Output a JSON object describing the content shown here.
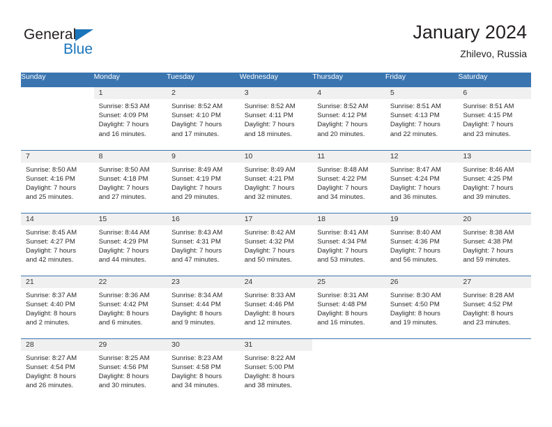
{
  "brand": {
    "word1": "General",
    "word2": "Blue",
    "flag_color": "#1b75bb"
  },
  "header": {
    "title": "January 2024",
    "subtitle": "Zhilevo, Russia"
  },
  "colors": {
    "header_row": "#3a75b0",
    "day_band": "#f0f0f0",
    "text": "#2b2b2b"
  },
  "weekdays": [
    "Sunday",
    "Monday",
    "Tuesday",
    "Wednesday",
    "Thursday",
    "Friday",
    "Saturday"
  ],
  "weeks": [
    [
      {
        "day": "",
        "lines": [],
        "blank": true
      },
      {
        "day": "1",
        "lines": [
          "Sunrise: 8:53 AM",
          "Sunset: 4:09 PM",
          "Daylight: 7 hours",
          "and 16 minutes."
        ]
      },
      {
        "day": "2",
        "lines": [
          "Sunrise: 8:52 AM",
          "Sunset: 4:10 PM",
          "Daylight: 7 hours",
          "and 17 minutes."
        ]
      },
      {
        "day": "3",
        "lines": [
          "Sunrise: 8:52 AM",
          "Sunset: 4:11 PM",
          "Daylight: 7 hours",
          "and 18 minutes."
        ]
      },
      {
        "day": "4",
        "lines": [
          "Sunrise: 8:52 AM",
          "Sunset: 4:12 PM",
          "Daylight: 7 hours",
          "and 20 minutes."
        ]
      },
      {
        "day": "5",
        "lines": [
          "Sunrise: 8:51 AM",
          "Sunset: 4:13 PM",
          "Daylight: 7 hours",
          "and 22 minutes."
        ]
      },
      {
        "day": "6",
        "lines": [
          "Sunrise: 8:51 AM",
          "Sunset: 4:15 PM",
          "Daylight: 7 hours",
          "and 23 minutes."
        ]
      }
    ],
    [
      {
        "day": "7",
        "lines": [
          "Sunrise: 8:50 AM",
          "Sunset: 4:16 PM",
          "Daylight: 7 hours",
          "and 25 minutes."
        ]
      },
      {
        "day": "8",
        "lines": [
          "Sunrise: 8:50 AM",
          "Sunset: 4:18 PM",
          "Daylight: 7 hours",
          "and 27 minutes."
        ]
      },
      {
        "day": "9",
        "lines": [
          "Sunrise: 8:49 AM",
          "Sunset: 4:19 PM",
          "Daylight: 7 hours",
          "and 29 minutes."
        ]
      },
      {
        "day": "10",
        "lines": [
          "Sunrise: 8:49 AM",
          "Sunset: 4:21 PM",
          "Daylight: 7 hours",
          "and 32 minutes."
        ]
      },
      {
        "day": "11",
        "lines": [
          "Sunrise: 8:48 AM",
          "Sunset: 4:22 PM",
          "Daylight: 7 hours",
          "and 34 minutes."
        ]
      },
      {
        "day": "12",
        "lines": [
          "Sunrise: 8:47 AM",
          "Sunset: 4:24 PM",
          "Daylight: 7 hours",
          "and 36 minutes."
        ]
      },
      {
        "day": "13",
        "lines": [
          "Sunrise: 8:46 AM",
          "Sunset: 4:25 PM",
          "Daylight: 7 hours",
          "and 39 minutes."
        ]
      }
    ],
    [
      {
        "day": "14",
        "lines": [
          "Sunrise: 8:45 AM",
          "Sunset: 4:27 PM",
          "Daylight: 7 hours",
          "and 42 minutes."
        ]
      },
      {
        "day": "15",
        "lines": [
          "Sunrise: 8:44 AM",
          "Sunset: 4:29 PM",
          "Daylight: 7 hours",
          "and 44 minutes."
        ]
      },
      {
        "day": "16",
        "lines": [
          "Sunrise: 8:43 AM",
          "Sunset: 4:31 PM",
          "Daylight: 7 hours",
          "and 47 minutes."
        ]
      },
      {
        "day": "17",
        "lines": [
          "Sunrise: 8:42 AM",
          "Sunset: 4:32 PM",
          "Daylight: 7 hours",
          "and 50 minutes."
        ]
      },
      {
        "day": "18",
        "lines": [
          "Sunrise: 8:41 AM",
          "Sunset: 4:34 PM",
          "Daylight: 7 hours",
          "and 53 minutes."
        ]
      },
      {
        "day": "19",
        "lines": [
          "Sunrise: 8:40 AM",
          "Sunset: 4:36 PM",
          "Daylight: 7 hours",
          "and 56 minutes."
        ]
      },
      {
        "day": "20",
        "lines": [
          "Sunrise: 8:38 AM",
          "Sunset: 4:38 PM",
          "Daylight: 7 hours",
          "and 59 minutes."
        ]
      }
    ],
    [
      {
        "day": "21",
        "lines": [
          "Sunrise: 8:37 AM",
          "Sunset: 4:40 PM",
          "Daylight: 8 hours",
          "and 2 minutes."
        ]
      },
      {
        "day": "22",
        "lines": [
          "Sunrise: 8:36 AM",
          "Sunset: 4:42 PM",
          "Daylight: 8 hours",
          "and 6 minutes."
        ]
      },
      {
        "day": "23",
        "lines": [
          "Sunrise: 8:34 AM",
          "Sunset: 4:44 PM",
          "Daylight: 8 hours",
          "and 9 minutes."
        ]
      },
      {
        "day": "24",
        "lines": [
          "Sunrise: 8:33 AM",
          "Sunset: 4:46 PM",
          "Daylight: 8 hours",
          "and 12 minutes."
        ]
      },
      {
        "day": "25",
        "lines": [
          "Sunrise: 8:31 AM",
          "Sunset: 4:48 PM",
          "Daylight: 8 hours",
          "and 16 minutes."
        ]
      },
      {
        "day": "26",
        "lines": [
          "Sunrise: 8:30 AM",
          "Sunset: 4:50 PM",
          "Daylight: 8 hours",
          "and 19 minutes."
        ]
      },
      {
        "day": "27",
        "lines": [
          "Sunrise: 8:28 AM",
          "Sunset: 4:52 PM",
          "Daylight: 8 hours",
          "and 23 minutes."
        ]
      }
    ],
    [
      {
        "day": "28",
        "lines": [
          "Sunrise: 8:27 AM",
          "Sunset: 4:54 PM",
          "Daylight: 8 hours",
          "and 26 minutes."
        ]
      },
      {
        "day": "29",
        "lines": [
          "Sunrise: 8:25 AM",
          "Sunset: 4:56 PM",
          "Daylight: 8 hours",
          "and 30 minutes."
        ]
      },
      {
        "day": "30",
        "lines": [
          "Sunrise: 8:23 AM",
          "Sunset: 4:58 PM",
          "Daylight: 8 hours",
          "and 34 minutes."
        ]
      },
      {
        "day": "31",
        "lines": [
          "Sunrise: 8:22 AM",
          "Sunset: 5:00 PM",
          "Daylight: 8 hours",
          "and 38 minutes."
        ]
      },
      {
        "day": "",
        "lines": [],
        "blank": true
      },
      {
        "day": "",
        "lines": [],
        "blank": true
      },
      {
        "day": "",
        "lines": [],
        "blank": true
      }
    ]
  ]
}
